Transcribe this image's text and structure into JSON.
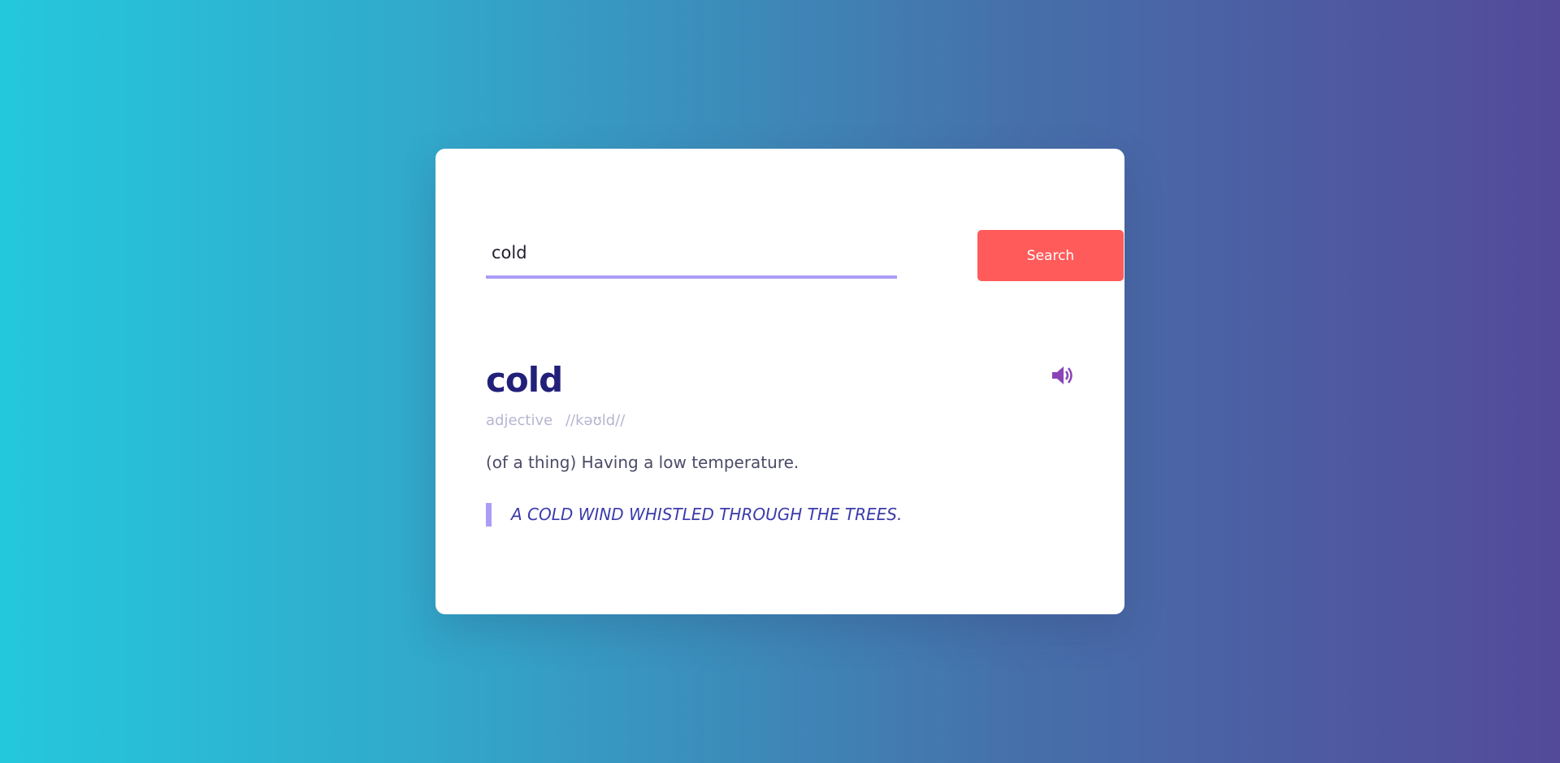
{
  "search": {
    "value": "cold",
    "button_label": "Search"
  },
  "result": {
    "word": "cold",
    "part_of_speech": "adjective",
    "phonetic": "//kəʊld//",
    "definition": "(of a thing) Having a low temperature.",
    "example": "A COLD WIND WHISTLED THROUGH THE TREES."
  },
  "icons": {
    "sound": "speaker-volume-icon"
  },
  "colors": {
    "accent": "#ac9cf6",
    "button": "#ff5b5b",
    "word": "#23207a",
    "speaker": "#8a44b5"
  }
}
